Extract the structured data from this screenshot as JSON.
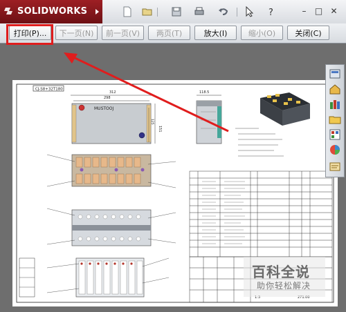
{
  "app": {
    "brand": "SOLIDWORKS"
  },
  "titlebar": {
    "icons": [
      "new-file-icon",
      "open-file-icon",
      "save-icon",
      "print-icon",
      "undo-icon",
      "select-icon",
      "help-icon"
    ],
    "window_controls": {
      "minimize": "–",
      "restore": "□",
      "close": "✕"
    }
  },
  "preview_toolbar": {
    "print": "打印(P)...",
    "next_page": "下一页(N)",
    "prev_page": "前一页(V)",
    "two_page": "两页(T)",
    "zoom_in": "放大(I)",
    "zoom_out": "缩小(O)",
    "close": "关闭(C)"
  },
  "drawing": {
    "title_block_code": "CJ-S8+32T180",
    "dim_top": "312",
    "dim_top2": "298",
    "dim_side": "118.5",
    "dim_height_a": "151",
    "dim_height_b": "125",
    "nameplate": "MUSTOOJ",
    "bottom_right_label": "271.00",
    "sheet_label": "1:3"
  },
  "taskpane": {
    "icons": [
      "resources-icon",
      "home-icon",
      "library-icon",
      "folder-icon",
      "palette-icon",
      "appearance-icon",
      "properties-icon"
    ]
  },
  "watermark": {
    "title": "百科全说",
    "subtitle": "助你轻松解决"
  },
  "colors": {
    "brand": "#8a181d",
    "highlight": "#e01d1d",
    "arrow": "#e01d1d"
  }
}
